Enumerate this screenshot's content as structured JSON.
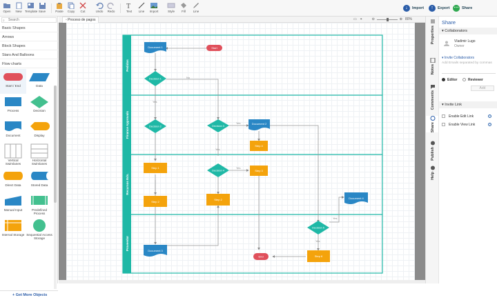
{
  "toolbar": {
    "open": "Open",
    "new": "New",
    "template": "Template",
    "save": "Save",
    "paste": "Paste",
    "copy": "Copy",
    "cut": "Cut",
    "undo": "Undo",
    "redo": "Redo",
    "text": "Text",
    "line": "Line",
    "import": "Import",
    "style": "Style",
    "fill": "Fill",
    "line2": "Line",
    "import_btn": "Import",
    "export_btn": "Export",
    "share_btn": "Share"
  },
  "sidebar": {
    "search_placeholder": "Search",
    "categories": [
      "Basic Shapes",
      "Arrows",
      "Block Shapes",
      "Stars And Balloons",
      "Flow charts"
    ],
    "shapes": [
      "Start / End",
      "Data",
      "Process",
      "Decision",
      "Document",
      "Display",
      "Vertical Swimlanes",
      "Horizontal Swimlanes",
      "Direct Data",
      "Stored Data",
      "Manual Input",
      "Predefined Process",
      "Internal Storage",
      "Sequential Access Storage"
    ],
    "get_more": "+ Get More Objects"
  },
  "tab": {
    "title": "Proceso de pagos"
  },
  "zoom": {
    "value": "80%"
  },
  "diagram": {
    "lanes": [
      "Pedidos",
      "Finance Approvals",
      "Recursos Eds.",
      "Proveedor"
    ],
    "nodes": {
      "doc1": "Document 1",
      "start": "Start",
      "dec1": "Decision 1",
      "dec2": "Decision 2",
      "dec3": "Decision 3",
      "doc2": "Document 2",
      "step4": "Step 4",
      "step1": "Step 1",
      "dec4": "Decision 4",
      "step3": "Step 3",
      "step2": "Step 2",
      "step2b": "Step 2",
      "doc4": "Document 4",
      "dec5": "Decision 5",
      "doc3": "Document 3",
      "end": "End",
      "step6": "Step 6"
    },
    "labels": {
      "no1": "No",
      "yes1": "Yes",
      "yes2": "Yes",
      "yes3": "Yes",
      "yes4": "Yes",
      "yes5": "Yes",
      "yes6": "Yes"
    }
  },
  "right_tabs": [
    "Properties",
    "Notes",
    "Comments",
    "Share",
    "Publish",
    "Help"
  ],
  "panel": {
    "title": "Share",
    "collaborators_hdr": "Collaborators",
    "collab_name": "Vladimir Lugo",
    "collab_role": "Owner",
    "invite_hdr": "Invite Collaborators",
    "invite_placeholder": "Add Emails separated by commas",
    "editor": "Editor",
    "reviewer": "Reviewer",
    "add": "Add",
    "invite_link_hdr": "Invite Link",
    "enable_edit": "Enable Edit Link",
    "enable_view": "Enable View Link"
  },
  "colors": {
    "teal": "#1fb8a6",
    "orange": "#f4a30c",
    "blue": "#2a87c5",
    "red": "#e0505b",
    "accent": "#2a5ca8"
  }
}
